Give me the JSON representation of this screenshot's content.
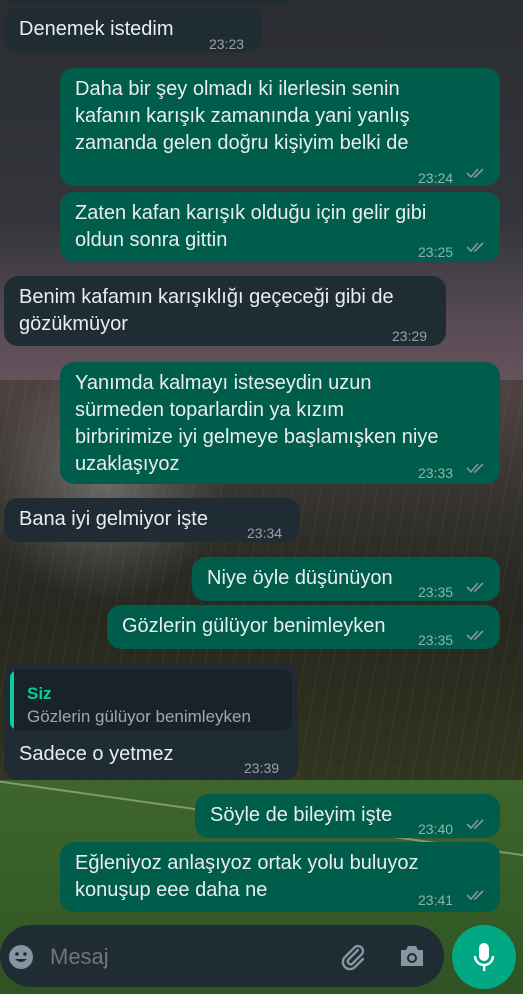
{
  "messages": [
    {
      "dir": "in",
      "text": "Denemek istedim",
      "time": "23:23"
    },
    {
      "dir": "out",
      "text": "Daha bir şey olmadı ki ilerlesin senin\nkafanın karışık zamanında yani yanlış\nzamanda gelen doğru kişiyim belki de",
      "time": "23:24"
    },
    {
      "dir": "out",
      "text": "Zaten kafan karışık olduğu için gelir gibi\noldun sonra gittin",
      "time": "23:25"
    },
    {
      "dir": "in",
      "text": "Benim kafamın karışıklığı geçeceği gibi de\ngözükmüyor",
      "time": "23:29"
    },
    {
      "dir": "out",
      "text": "Yanımda kalmayı isteseydin uzun\nsürmeden toparlardin ya kızım\nbirbririmize iyi gelmeye başlamışken niye\nuzaklaşıyoz",
      "time": "23:33"
    },
    {
      "dir": "in",
      "text": "Bana iyi gelmiyor işte",
      "time": "23:34"
    },
    {
      "dir": "out",
      "text": "Niye öyle düşünüyon",
      "time": "23:35"
    },
    {
      "dir": "out",
      "text": "Gözlerin gülüyor benimleyken",
      "time": "23:35"
    },
    {
      "dir": "in",
      "text": "Sadece o yetmez",
      "time": "23:39",
      "quote": {
        "author": "Siz",
        "text": "Gözlerin gülüyor benimleyken"
      }
    },
    {
      "dir": "out",
      "text": "Söyle de bileyim işte",
      "time": "23:40"
    },
    {
      "dir": "out",
      "text": "Eğleniyoz anlaşıyoz ortak yolu buluyoz\nkonuşup eee daha ne",
      "time": "23:41"
    }
  ],
  "composer": {
    "placeholder": "Mesaj"
  },
  "icons": {
    "emoji": "emoji-icon",
    "attach": "paperclip-icon",
    "camera": "camera-icon",
    "mic": "microphone-icon",
    "read": "double-check-icon"
  },
  "colors": {
    "incoming": "#1f2c34",
    "outgoing": "#005c4b",
    "mic_button": "#00a884",
    "ticks": "#8696a0"
  }
}
